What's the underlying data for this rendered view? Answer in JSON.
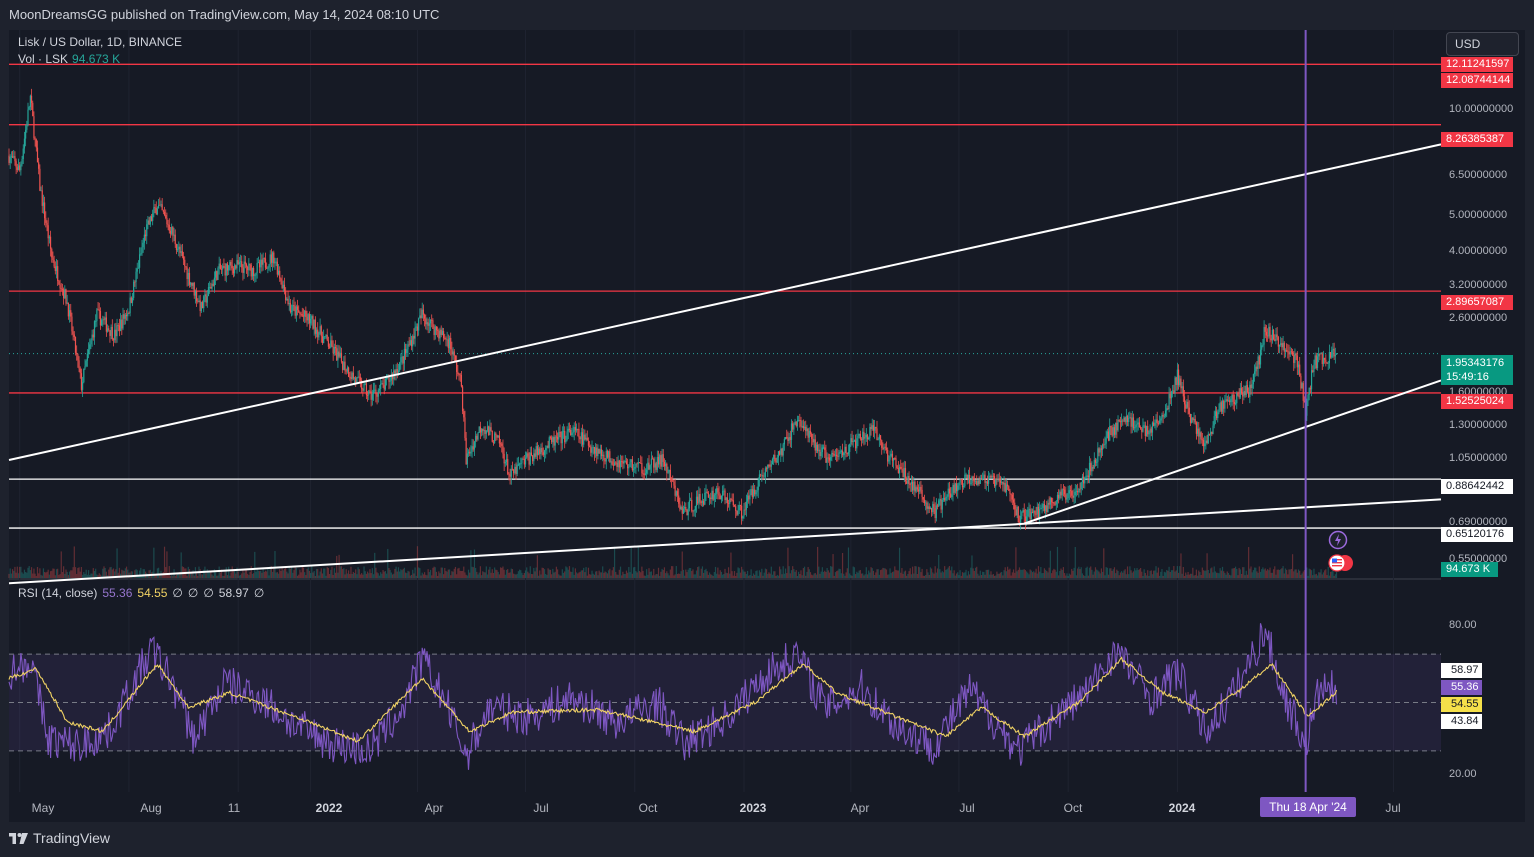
{
  "header": {
    "publisher_line": "MoonDreamsGG published on TradingView.com, May 14, 2024 08:10 UTC"
  },
  "legend": {
    "symbol": "Lisk / US Dollar, 1D, BINANCE",
    "vol_label": "Vol · LSK",
    "vol_value": "94.673 K",
    "rsi_label": "RSI (14, close)",
    "rsi_value": "55.36",
    "rsi_ma_value": "54.55",
    "rsi_off_1": "∅",
    "rsi_off_2": "∅",
    "rsi_off_3": "∅",
    "rsi_extra": "58.97",
    "rsi_off_4": "∅"
  },
  "currency_button": "USD",
  "brand": "TradingView",
  "colors": {
    "up": "#26a69a",
    "down": "#ef5350",
    "resistance": "#f23645",
    "support": "#ffffff",
    "trendline": "#ffffff",
    "rsi": "#7e57c2",
    "rsi_ma": "#f0d264",
    "cursor": "#7e57c2",
    "background": "#161a25"
  },
  "chart_data": [
    {
      "type": "candlestick",
      "title": "Lisk / US Dollar, 1D, BINANCE",
      "y_scale": "log",
      "x_range": [
        "2021-04-22",
        "2024-08-10"
      ],
      "y_ticks": [
        "12.11241597",
        "10.00000000",
        "6.50000000",
        "5.00000000",
        "4.00000000",
        "3.20000000",
        "2.60000000",
        "1.60000000",
        "1.30000000",
        "1.05000000",
        "0.69000000",
        "0.55000000"
      ],
      "x_ticks": [
        {
          "date": "2021-05-01",
          "label": "May"
        },
        {
          "date": "2021-08-01",
          "label": "Aug"
        },
        {
          "date": "2021-11-01",
          "label": "11"
        },
        {
          "date": "2022-01-01",
          "label": "2022",
          "bold": true
        },
        {
          "date": "2022-04-01",
          "label": "Apr"
        },
        {
          "date": "2022-07-01",
          "label": "Jul"
        },
        {
          "date": "2022-10-01",
          "label": "Oct"
        },
        {
          "date": "2023-01-01",
          "label": "2023",
          "bold": true
        },
        {
          "date": "2023-04-01",
          "label": "Apr"
        },
        {
          "date": "2023-07-01",
          "label": "Jul"
        },
        {
          "date": "2023-10-01",
          "label": "Oct"
        },
        {
          "date": "2024-01-01",
          "label": "2024",
          "bold": true
        },
        {
          "date": "2024-07-01",
          "label": "Jul"
        }
      ],
      "price_path": [
        {
          "date": "2021-04-22",
          "close": 6.8
        },
        {
          "date": "2021-05-01",
          "close": 6.2
        },
        {
          "date": "2021-05-10",
          "close": 9.8
        },
        {
          "date": "2021-05-18",
          "close": 5.6
        },
        {
          "date": "2021-05-28",
          "close": 3.6
        },
        {
          "date": "2021-06-10",
          "close": 2.7
        },
        {
          "date": "2021-06-22",
          "close": 1.6
        },
        {
          "date": "2021-07-05",
          "close": 2.5
        },
        {
          "date": "2021-07-20",
          "close": 2.2
        },
        {
          "date": "2021-08-01",
          "close": 2.6
        },
        {
          "date": "2021-08-15",
          "close": 4.2
        },
        {
          "date": "2021-08-25",
          "close": 5.0
        },
        {
          "date": "2021-09-05",
          "close": 4.3
        },
        {
          "date": "2021-09-20",
          "close": 3.2
        },
        {
          "date": "2021-10-01",
          "close": 2.6
        },
        {
          "date": "2021-10-15",
          "close": 3.3
        },
        {
          "date": "2021-11-01",
          "close": 3.4
        },
        {
          "date": "2021-11-15",
          "close": 3.3
        },
        {
          "date": "2021-12-01",
          "close": 3.6
        },
        {
          "date": "2021-12-15",
          "close": 2.6
        },
        {
          "date": "2022-01-01",
          "close": 2.4
        },
        {
          "date": "2022-01-20",
          "close": 2.0
        },
        {
          "date": "2022-02-05",
          "close": 1.7
        },
        {
          "date": "2022-02-20",
          "close": 1.5
        },
        {
          "date": "2022-03-05",
          "close": 1.6
        },
        {
          "date": "2022-03-20",
          "close": 1.9
        },
        {
          "date": "2022-04-05",
          "close": 2.5
        },
        {
          "date": "2022-04-15",
          "close": 2.3
        },
        {
          "date": "2022-04-28",
          "close": 2.1
        },
        {
          "date": "2022-05-08",
          "close": 1.6
        },
        {
          "date": "2022-05-12",
          "close": 1.0
        },
        {
          "date": "2022-05-25",
          "close": 1.25
        },
        {
          "date": "2022-06-10",
          "close": 1.1
        },
        {
          "date": "2022-06-18",
          "close": 0.9
        },
        {
          "date": "2022-07-01",
          "close": 1.0
        },
        {
          "date": "2022-07-20",
          "close": 1.1
        },
        {
          "date": "2022-08-10",
          "close": 1.2
        },
        {
          "date": "2022-09-01",
          "close": 1.05
        },
        {
          "date": "2022-09-20",
          "close": 0.98
        },
        {
          "date": "2022-10-10",
          "close": 0.95
        },
        {
          "date": "2022-10-25",
          "close": 1.0
        },
        {
          "date": "2022-11-10",
          "close": 0.72
        },
        {
          "date": "2022-11-25",
          "close": 0.78
        },
        {
          "date": "2022-12-10",
          "close": 0.82
        },
        {
          "date": "2022-12-30",
          "close": 0.72
        },
        {
          "date": "2023-01-15",
          "close": 0.9
        },
        {
          "date": "2023-02-01",
          "close": 1.05
        },
        {
          "date": "2023-02-15",
          "close": 1.3
        },
        {
          "date": "2023-03-01",
          "close": 1.1
        },
        {
          "date": "2023-03-15",
          "close": 1.0
        },
        {
          "date": "2023-04-01",
          "close": 1.1
        },
        {
          "date": "2023-04-20",
          "close": 1.2
        },
        {
          "date": "2023-05-05",
          "close": 1.0
        },
        {
          "date": "2023-05-20",
          "close": 0.88
        },
        {
          "date": "2023-06-10",
          "close": 0.72
        },
        {
          "date": "2023-06-25",
          "close": 0.82
        },
        {
          "date": "2023-07-10",
          "close": 0.9
        },
        {
          "date": "2023-07-25",
          "close": 0.88
        },
        {
          "date": "2023-08-10",
          "close": 0.85
        },
        {
          "date": "2023-08-20",
          "close": 0.7
        },
        {
          "date": "2023-09-05",
          "close": 0.72
        },
        {
          "date": "2023-09-20",
          "close": 0.78
        },
        {
          "date": "2023-10-05",
          "close": 0.82
        },
        {
          "date": "2023-10-20",
          "close": 0.95
        },
        {
          "date": "2023-11-05",
          "close": 1.2
        },
        {
          "date": "2023-11-20",
          "close": 1.3
        },
        {
          "date": "2023-12-05",
          "close": 1.2
        },
        {
          "date": "2023-12-20",
          "close": 1.3
        },
        {
          "date": "2024-01-01",
          "close": 1.7
        },
        {
          "date": "2024-01-12",
          "close": 1.3
        },
        {
          "date": "2024-01-25",
          "close": 1.1
        },
        {
          "date": "2024-02-05",
          "close": 1.4
        },
        {
          "date": "2024-02-20",
          "close": 1.5
        },
        {
          "date": "2024-03-01",
          "close": 1.55
        },
        {
          "date": "2024-03-10",
          "close": 1.9
        },
        {
          "date": "2024-03-15",
          "close": 2.3
        },
        {
          "date": "2024-03-25",
          "close": 2.1
        },
        {
          "date": "2024-04-05",
          "close": 2.0
        },
        {
          "date": "2024-04-12",
          "close": 1.8
        },
        {
          "date": "2024-04-18",
          "close": 1.35
        },
        {
          "date": "2024-04-25",
          "close": 1.85
        },
        {
          "date": "2024-05-05",
          "close": 1.9
        },
        {
          "date": "2024-05-14",
          "close": 1.95
        }
      ],
      "resistance_levels": [
        12.08744144,
        8.26385387,
        2.89657087,
        1.52525024
      ],
      "support_levels": [
        0.88642442,
        0.65120176
      ],
      "trendlines": [
        {
          "from": {
            "date": "2021-04-22",
            "price": 1.0
          },
          "to": {
            "date": "2024-08-10",
            "price": 7.3
          }
        },
        {
          "from": {
            "date": "2021-04-22",
            "price": 0.46
          },
          "to": {
            "date": "2024-08-10",
            "price": 0.78
          }
        },
        {
          "from": {
            "date": "2023-08-25",
            "price": 0.67
          },
          "to": {
            "date": "2024-08-10",
            "price": 1.65
          }
        }
      ],
      "price_labels": [
        {
          "value": "12.11241597",
          "style": "red"
        },
        {
          "value": "12.08744144",
          "style": "red"
        },
        {
          "value": "8.26385387",
          "style": "red"
        },
        {
          "value": "2.89657087",
          "style": "red"
        },
        {
          "value": "1.95343176",
          "style": "green",
          "sub": "15:49:16"
        },
        {
          "value": "1.52525024",
          "style": "red"
        },
        {
          "value": "0.88642442",
          "style": "white"
        },
        {
          "value": "0.65120176",
          "style": "white"
        },
        {
          "value": "94.673 K",
          "style": "vol"
        }
      ],
      "last_price": 1.95343176,
      "countdown": "15:49:16",
      "volume_last": "94.673 K",
      "cursor_date": "2024-04-18",
      "cursor_label": "Thu 18 Apr '24"
    },
    {
      "type": "line",
      "title": "RSI (14, close)",
      "ylim": [
        20,
        100
      ],
      "y_ticks": [
        "80.00",
        "20.00"
      ],
      "bands": [
        30,
        50,
        70
      ],
      "series": [
        {
          "name": "RSI",
          "points": [
            {
              "date": "2021-04-22",
              "value": 62
            },
            {
              "date": "2021-05-10",
              "value": 68
            },
            {
              "date": "2021-05-25",
              "value": 35
            },
            {
              "date": "2021-06-20",
              "value": 32
            },
            {
              "date": "2021-07-15",
              "value": 38
            },
            {
              "date": "2021-08-20",
              "value": 72
            },
            {
              "date": "2021-09-05",
              "value": 60
            },
            {
              "date": "2021-09-25",
              "value": 35
            },
            {
              "date": "2021-10-20",
              "value": 58
            },
            {
              "date": "2021-11-20",
              "value": 52
            },
            {
              "date": "2021-12-20",
              "value": 40
            },
            {
              "date": "2022-01-20",
              "value": 33
            },
            {
              "date": "2022-02-20",
              "value": 30
            },
            {
              "date": "2022-03-20",
              "value": 48
            },
            {
              "date": "2022-04-05",
              "value": 68
            },
            {
              "date": "2022-04-25",
              "value": 50
            },
            {
              "date": "2022-05-12",
              "value": 28
            },
            {
              "date": "2022-06-01",
              "value": 48
            },
            {
              "date": "2022-07-01",
              "value": 44
            },
            {
              "date": "2022-08-10",
              "value": 52
            },
            {
              "date": "2022-09-15",
              "value": 42
            },
            {
              "date": "2022-10-20",
              "value": 50
            },
            {
              "date": "2022-11-12",
              "value": 33
            },
            {
              "date": "2022-12-20",
              "value": 45
            },
            {
              "date": "2023-01-20",
              "value": 62
            },
            {
              "date": "2023-02-15",
              "value": 70
            },
            {
              "date": "2023-03-10",
              "value": 48
            },
            {
              "date": "2023-04-10",
              "value": 56
            },
            {
              "date": "2023-05-10",
              "value": 40
            },
            {
              "date": "2023-06-10",
              "value": 32
            },
            {
              "date": "2023-07-10",
              "value": 55
            },
            {
              "date": "2023-08-20",
              "value": 30
            },
            {
              "date": "2023-09-20",
              "value": 44
            },
            {
              "date": "2023-10-20",
              "value": 56
            },
            {
              "date": "2023-11-10",
              "value": 72
            },
            {
              "date": "2023-12-10",
              "value": 52
            },
            {
              "date": "2024-01-01",
              "value": 63
            },
            {
              "date": "2024-01-25",
              "value": 38
            },
            {
              "date": "2024-02-20",
              "value": 56
            },
            {
              "date": "2024-03-15",
              "value": 80
            },
            {
              "date": "2024-03-30",
              "value": 54
            },
            {
              "date": "2024-04-18",
              "value": 33
            },
            {
              "date": "2024-04-30",
              "value": 56
            },
            {
              "date": "2024-05-14",
              "value": 55.36
            }
          ]
        },
        {
          "name": "RSI-based MA",
          "points": [
            {
              "date": "2021-04-22",
              "value": 60
            },
            {
              "date": "2021-05-15",
              "value": 64
            },
            {
              "date": "2021-06-10",
              "value": 42
            },
            {
              "date": "2021-07-10",
              "value": 38
            },
            {
              "date": "2021-08-25",
              "value": 66
            },
            {
              "date": "2021-09-20",
              "value": 48
            },
            {
              "date": "2021-10-25",
              "value": 54
            },
            {
              "date": "2021-12-20",
              "value": 44
            },
            {
              "date": "2022-02-10",
              "value": 34
            },
            {
              "date": "2022-04-05",
              "value": 60
            },
            {
              "date": "2022-05-15",
              "value": 38
            },
            {
              "date": "2022-06-20",
              "value": 46
            },
            {
              "date": "2022-09-01",
              "value": 47
            },
            {
              "date": "2022-11-20",
              "value": 38
            },
            {
              "date": "2023-01-10",
              "value": 50
            },
            {
              "date": "2023-02-20",
              "value": 66
            },
            {
              "date": "2023-03-20",
              "value": 54
            },
            {
              "date": "2023-05-20",
              "value": 42
            },
            {
              "date": "2023-06-20",
              "value": 36
            },
            {
              "date": "2023-07-20",
              "value": 48
            },
            {
              "date": "2023-08-25",
              "value": 36
            },
            {
              "date": "2023-10-10",
              "value": 50
            },
            {
              "date": "2023-11-15",
              "value": 68
            },
            {
              "date": "2023-12-20",
              "value": 54
            },
            {
              "date": "2024-01-25",
              "value": 46
            },
            {
              "date": "2024-02-25",
              "value": 56
            },
            {
              "date": "2024-03-20",
              "value": 66
            },
            {
              "date": "2024-04-20",
              "value": 44
            },
            {
              "date": "2024-05-14",
              "value": 54.55
            }
          ]
        }
      ],
      "value_labels": [
        {
          "value": "58.97",
          "style": "white"
        },
        {
          "value": "55.36",
          "style": "purple"
        },
        {
          "value": "54.55",
          "style": "yellow"
        },
        {
          "value": "43.84",
          "style": "white"
        }
      ]
    }
  ]
}
